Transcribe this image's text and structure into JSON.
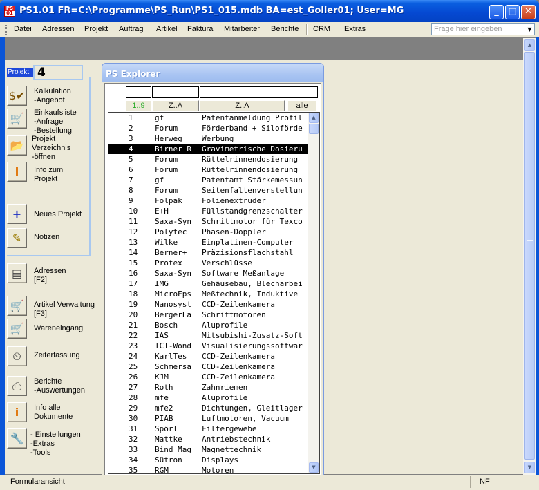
{
  "window": {
    "title": "PS1.01   FR=C:\\Programme\\PS_Run\\PS1_015.mdb  BA=est_Goller01;  User=MG",
    "icon": "app-icon",
    "minimize_label": "_",
    "maximize_label": "□",
    "close_label": "✕"
  },
  "menu": {
    "items": [
      "Datei",
      "Adressen",
      "Projekt",
      "Auftrag",
      "Artikel",
      "Faktura",
      "Mitarbeiter",
      "Berichte",
      "CRM",
      "Extras"
    ],
    "help_placeholder": "Frage hier eingeben"
  },
  "left_panel": {
    "section_label": "Projekt",
    "project_number": "4",
    "buttons": [
      {
        "icon": "dollar-check-icon",
        "label": "Kalkulation\n-Angebot"
      },
      {
        "icon": "cart-icon",
        "label": "Einkaufsliste\n-Anfrage\n-Bestellung"
      },
      {
        "icon": "folder-open-icon",
        "label": "Projekt\nVerzeichnis\n-öffnen"
      },
      {
        "icon": "info-icon",
        "label": "Info zum\nProjekt"
      },
      {
        "icon": "plus-icon",
        "label": "Neues Projekt"
      },
      {
        "icon": "notes-icon",
        "label": "Notizen"
      },
      {
        "icon": "address-card-icon",
        "label": "Adressen\n[F2]"
      },
      {
        "icon": "cart-icon",
        "label": "Artikel Verwaltung\n[F3]"
      },
      {
        "icon": "cart-arrow-icon",
        "label": "Wareneingang"
      },
      {
        "icon": "clock-icon",
        "label": "Zeiterfassung"
      },
      {
        "icon": "printer-icon",
        "label": "Berichte\n-Auswertungen"
      },
      {
        "icon": "info-icon",
        "label": "Info alle\nDokumente"
      },
      {
        "icon": "wrench-icon",
        "label": "- Einstellungen\n-Extras\n-Tools"
      }
    ]
  },
  "explorer": {
    "title": "PS Explorer",
    "headers": [
      "1..9",
      "Z..A",
      "Z..A",
      "alle"
    ],
    "header_number_color": "#22aa22",
    "selected_row": 4,
    "rows": [
      {
        "id": "1",
        "kunde": "gf",
        "bez": "Patentanmeldung Profil"
      },
      {
        "id": "2",
        "kunde": "Forum",
        "bez": "Förderband + Silofördе"
      },
      {
        "id": "3",
        "kunde": "Herweg",
        "bez": "Werbung"
      },
      {
        "id": "4",
        "kunde": "Birner_R",
        "bez": "Gravimetrische Dosieru"
      },
      {
        "id": "5",
        "kunde": "Forum",
        "bez": "Rüttelrinnendosierung"
      },
      {
        "id": "6",
        "kunde": "Forum",
        "bez": "Rüttelrinnendosierung"
      },
      {
        "id": "7",
        "kunde": "gf",
        "bez": "Patentamt Stärkemessun"
      },
      {
        "id": "8",
        "kunde": "Forum",
        "bez": "Seitenfaltenverstellun"
      },
      {
        "id": "9",
        "kunde": "Folpak",
        "bez": "Folienextruder"
      },
      {
        "id": "10",
        "kunde": "E+H",
        "bez": "Füllstandgrenzschalter"
      },
      {
        "id": "11",
        "kunde": "Saxa-Syn",
        "bez": "Schrittmotor für Texco"
      },
      {
        "id": "12",
        "kunde": "Polytec",
        "bez": "Phasen-Doppler"
      },
      {
        "id": "13",
        "kunde": "Wilke",
        "bez": "Einplatinen-Computer"
      },
      {
        "id": "14",
        "kunde": "Berner+",
        "bez": "Präzisionsflachstahl"
      },
      {
        "id": "15",
        "kunde": "Protex",
        "bez": "Verschlüsse"
      },
      {
        "id": "16",
        "kunde": "Saxa-Syn",
        "bez": "Software Meßanlage"
      },
      {
        "id": "17",
        "kunde": "IMG",
        "bez": "Gehäusebau, Blecharbei"
      },
      {
        "id": "18",
        "kunde": "MicroEps",
        "bez": "Meßtechnik, Induktive"
      },
      {
        "id": "19",
        "kunde": "Nanosyst",
        "bez": "CCD-Zeilenkamera"
      },
      {
        "id": "20",
        "kunde": "BergerLa",
        "bez": "Schrittmotoren"
      },
      {
        "id": "21",
        "kunde": "Bosch",
        "bez": "Aluprofile"
      },
      {
        "id": "22",
        "kunde": "IAS",
        "bez": "Mitsubishi-Zusatz-Soft"
      },
      {
        "id": "23",
        "kunde": "ICT-Wond",
        "bez": "Visualisierungssoftwar"
      },
      {
        "id": "24",
        "kunde": "KarlTes",
        "bez": "CCD-Zeilenkamera"
      },
      {
        "id": "25",
        "kunde": "Schmersa",
        "bez": "CCD-Zeilenkamera"
      },
      {
        "id": "26",
        "kunde": "KJM",
        "bez": "CCD-Zeilenkamera"
      },
      {
        "id": "27",
        "kunde": "Roth",
        "bez": "Zahnriemen"
      },
      {
        "id": "28",
        "kunde": "mfe",
        "bez": "Aluprofile"
      },
      {
        "id": "29",
        "kunde": "mfe2",
        "bez": "Dichtungen, Gleitlager"
      },
      {
        "id": "30",
        "kunde": "PIAB",
        "bez": "Luftmotoren, Vacuum"
      },
      {
        "id": "31",
        "kunde": "Spörl",
        "bez": "Filtergewebe"
      },
      {
        "id": "32",
        "kunde": "Mattke",
        "bez": "Antriebstechnik"
      },
      {
        "id": "33",
        "kunde": "Bind Mag",
        "bez": "Magnettechnik"
      },
      {
        "id": "34",
        "kunde": "Sütron",
        "bez": "Displays"
      },
      {
        "id": "35",
        "kunde": "RGM",
        "bez": "Motoren"
      }
    ]
  },
  "status": {
    "left": "Formularansicht",
    "right": "NF"
  }
}
